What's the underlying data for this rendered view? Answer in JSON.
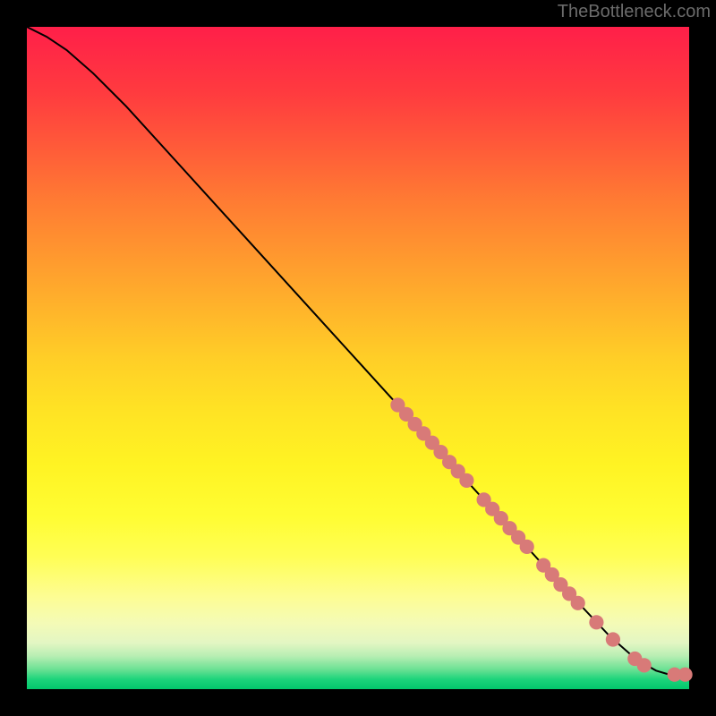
{
  "watermark": "TheBottleneck.com",
  "chart_data": {
    "type": "line",
    "title": "",
    "xlabel": "",
    "ylabel": "",
    "xlim": [
      0,
      100
    ],
    "ylim": [
      0,
      100
    ],
    "grid": false,
    "legend": false,
    "background_gradient": {
      "top": "#ff1f49",
      "middle": "#ffe324",
      "bottom": "#02c76c"
    },
    "curve": {
      "description": "Monotone decreasing bottleneck curve starting near (0,100) and flattening to (100,~2)",
      "points": [
        {
          "x": 0,
          "y": 100
        },
        {
          "x": 3,
          "y": 98.5
        },
        {
          "x": 6,
          "y": 96.5
        },
        {
          "x": 10,
          "y": 93
        },
        {
          "x": 15,
          "y": 88
        },
        {
          "x": 20,
          "y": 82.5
        },
        {
          "x": 30,
          "y": 71.5
        },
        {
          "x": 40,
          "y": 60.5
        },
        {
          "x": 50,
          "y": 49.5
        },
        {
          "x": 60,
          "y": 38.5
        },
        {
          "x": 70,
          "y": 27.5
        },
        {
          "x": 80,
          "y": 16.5
        },
        {
          "x": 88,
          "y": 8
        },
        {
          "x": 92,
          "y": 4.5
        },
        {
          "x": 95,
          "y": 2.8
        },
        {
          "x": 97,
          "y": 2.2
        },
        {
          "x": 100,
          "y": 2.3
        }
      ]
    },
    "markers": {
      "radius_pct": 1.1,
      "color": "#d87a78",
      "points": [
        {
          "x": 56.0,
          "y": 42.9
        },
        {
          "x": 57.3,
          "y": 41.5
        },
        {
          "x": 58.6,
          "y": 40.0
        },
        {
          "x": 59.9,
          "y": 38.6
        },
        {
          "x": 61.2,
          "y": 37.2
        },
        {
          "x": 62.5,
          "y": 35.8
        },
        {
          "x": 63.8,
          "y": 34.3
        },
        {
          "x": 65.1,
          "y": 32.9
        },
        {
          "x": 66.4,
          "y": 31.5
        },
        {
          "x": 69.0,
          "y": 28.6
        },
        {
          "x": 70.3,
          "y": 27.2
        },
        {
          "x": 71.6,
          "y": 25.8
        },
        {
          "x": 72.9,
          "y": 24.3
        },
        {
          "x": 74.2,
          "y": 22.9
        },
        {
          "x": 75.5,
          "y": 21.5
        },
        {
          "x": 78.0,
          "y": 18.7
        },
        {
          "x": 79.3,
          "y": 17.3
        },
        {
          "x": 80.6,
          "y": 15.8
        },
        {
          "x": 81.9,
          "y": 14.4
        },
        {
          "x": 83.2,
          "y": 13.0
        },
        {
          "x": 86.0,
          "y": 10.1
        },
        {
          "x": 88.5,
          "y": 7.5
        },
        {
          "x": 91.8,
          "y": 4.6
        },
        {
          "x": 93.2,
          "y": 3.6
        },
        {
          "x": 97.8,
          "y": 2.2
        },
        {
          "x": 99.4,
          "y": 2.2
        }
      ]
    }
  }
}
